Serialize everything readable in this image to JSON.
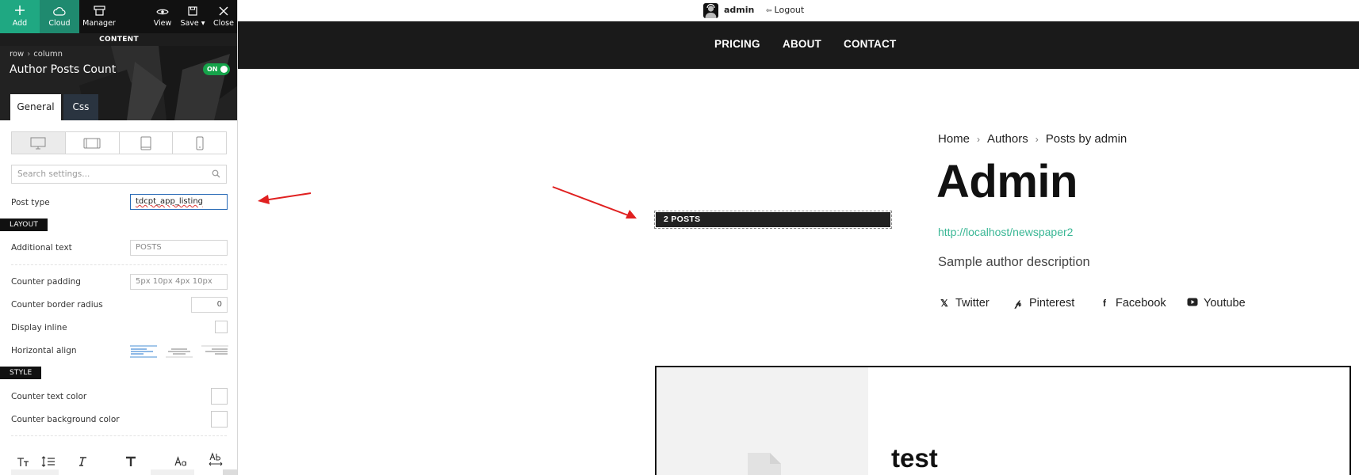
{
  "toolbar": {
    "add_label": "Add",
    "cloud_label": "Cloud",
    "manager_label": "Manager",
    "view_label": "View",
    "save_label": "Save",
    "close_label": "Close"
  },
  "panel": {
    "section_label": "CONTENT",
    "breadcrumb": [
      "row",
      "column"
    ],
    "title": "Author Posts Count",
    "toggle_label": "ON",
    "tabs": [
      "General",
      "Css"
    ],
    "search_placeholder": "Search settings...",
    "post_type": {
      "label": "Post type",
      "value": "tdcpt_app_listing"
    },
    "layout_label": "LAYOUT",
    "additional_text": {
      "label": "Additional text",
      "placeholder": "POSTS"
    },
    "counter_padding": {
      "label": "Counter padding",
      "placeholder": "5px 10px 4px 10px"
    },
    "counter_border_radius": {
      "label": "Counter border radius",
      "placeholder": "0"
    },
    "display_inline": {
      "label": "Display inline"
    },
    "horizontal_align": {
      "label": "Horizontal align"
    },
    "style_label": "STYLE",
    "counter_text_color": {
      "label": "Counter text color"
    },
    "counter_bg_color": {
      "label": "Counter background color"
    }
  },
  "adminbar": {
    "user": "admin",
    "logout": "Logout"
  },
  "nav": {
    "items": [
      "PRICING",
      "ABOUT",
      "CONTACT"
    ]
  },
  "author": {
    "breadcrumb": [
      "Home",
      "Authors",
      "Posts by admin"
    ],
    "name": "Admin",
    "url": "http://localhost/newspaper2",
    "description": "Sample author description",
    "socials": [
      "Twitter",
      "Pinterest",
      "Facebook",
      "Youtube"
    ]
  },
  "posts_count": "2 POSTS",
  "post_card": {
    "title": "test"
  },
  "colors": {
    "accent_green": "#1fa882",
    "link_green": "#3ab795",
    "nav_bg": "#1a1a1a",
    "annotation_red": "#e02020"
  }
}
